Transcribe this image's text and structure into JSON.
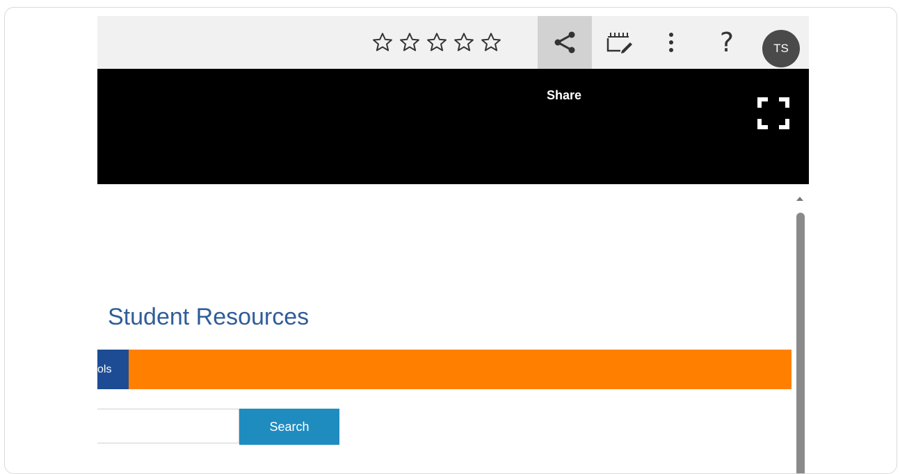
{
  "toolbar": {
    "rating_icons": [
      "star-outline-icon",
      "star-outline-icon",
      "star-outline-icon",
      "star-outline-icon",
      "star-outline-icon"
    ],
    "share_icon": "share-icon",
    "edit_icon": "clapperboard-edit-icon",
    "more_icon": "vertical-dots-icon",
    "help_label": "?",
    "avatar_initials": "TS"
  },
  "video": {
    "share_tooltip": "Share",
    "fullscreen_icon": "fullscreen-icon"
  },
  "page": {
    "heading": "Student Resources",
    "nav_tab_label": "ols",
    "search_placeholder": "",
    "search_button": "Search"
  },
  "colors": {
    "heading": "#2f5d98",
    "nav_bar": "#ff8000",
    "nav_tab": "#1d4c94",
    "search_button": "#1f8cc0",
    "avatar": "#4a4a4a"
  }
}
